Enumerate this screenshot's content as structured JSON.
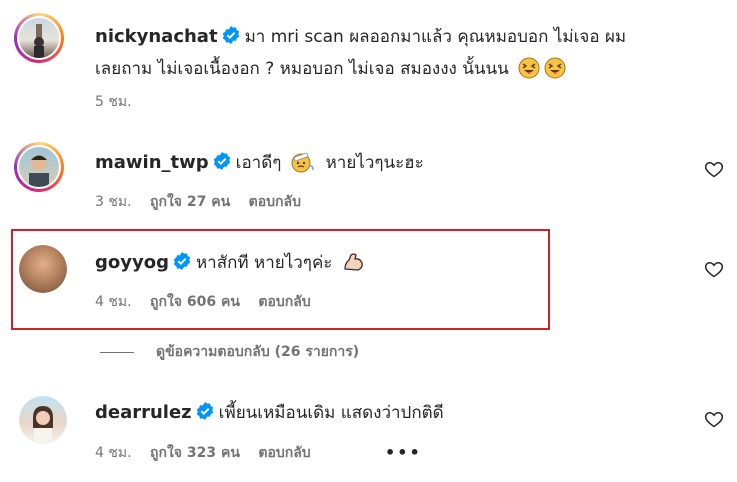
{
  "comments": [
    {
      "username": "nickynachat",
      "text_line1": "มา mri scan ผลออกมาแล้ว คุณหมอบอก ไม่เจอ ผม",
      "text_line2": "เลยถาม ไม่เจอเนื้องอก ? หมอบอก ไม่เจอ สมองงง นั้นนน",
      "time": "5 ชม."
    },
    {
      "username": "mawin_twp",
      "text": "เอาดีๆ",
      "text_after": "หายไวๆนะฮะ",
      "time": "3 ชม.",
      "likes": "ถูกใจ 27 คน",
      "reply": "ตอบกลับ"
    },
    {
      "username": "goyyog",
      "text": "หาสักที หายไวๆค่ะ",
      "time": "4 ชม.",
      "likes": "ถูกใจ 606 คน",
      "reply": "ตอบกลับ"
    },
    {
      "username": "dearrulez",
      "text": "เพี้ยนเหมือนเดิม แสดงว่าปกติดี",
      "time": "4 ชม.",
      "likes": "ถูกใจ 323 คน",
      "reply": "ตอบกลับ",
      "more": "•••"
    }
  ],
  "view_replies": "ดูข้อความตอบกลับ (26 รายการ)",
  "colors": {
    "verified": "#0095f6",
    "highlight_border": "#cc2229",
    "meta_text": "#737373"
  },
  "icons": [
    "verified-badge-icon",
    "heart-icon",
    "more-options-icon"
  ]
}
